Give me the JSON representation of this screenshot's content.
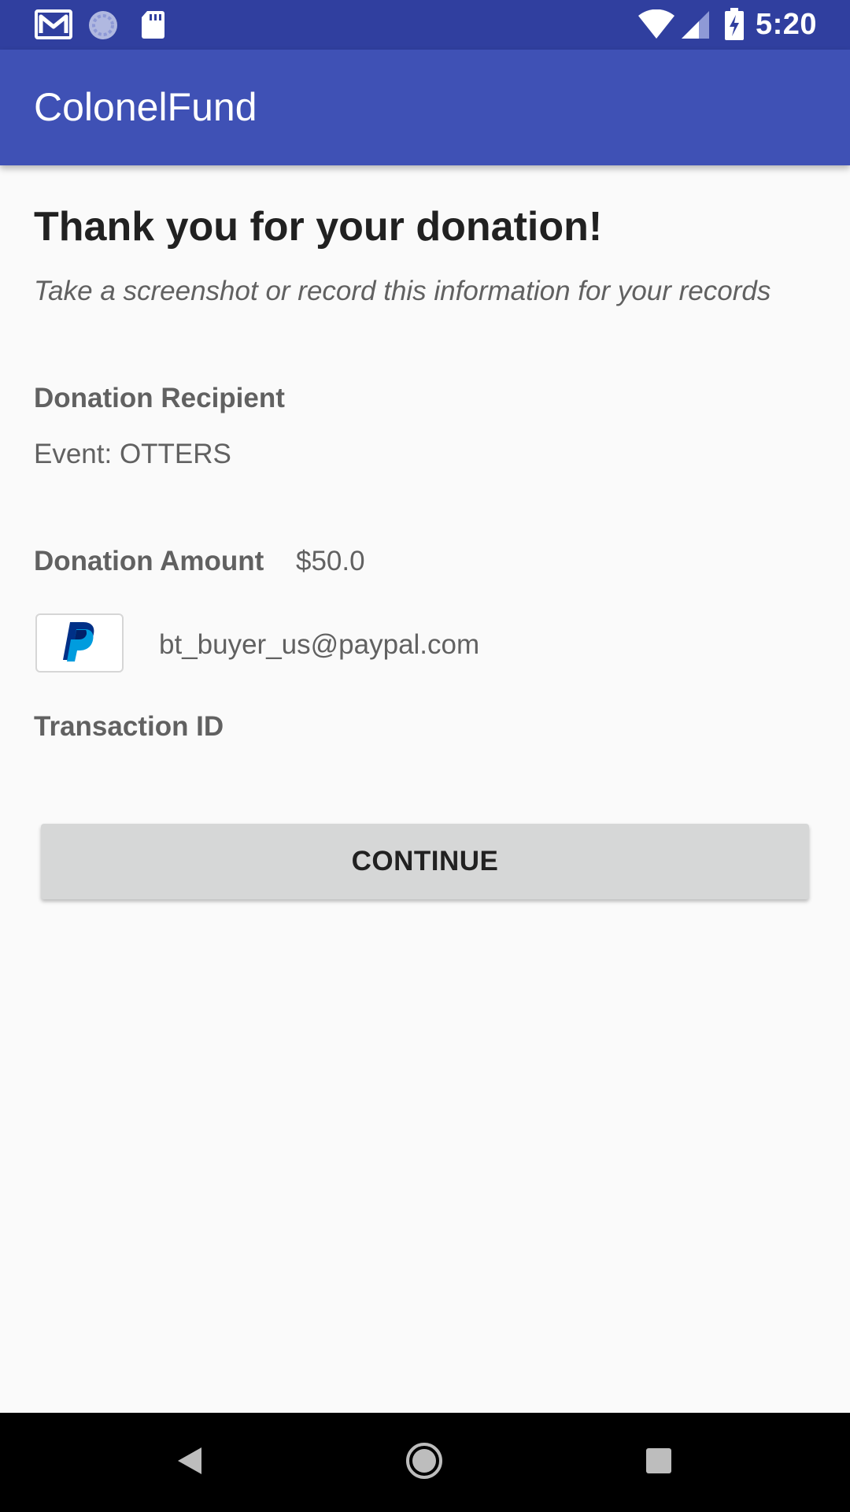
{
  "status_bar": {
    "time": "5:20",
    "icons": [
      "gmail-icon",
      "sync-icon",
      "sd-card-icon",
      "wifi-icon",
      "signal-icon",
      "battery-charging-icon"
    ]
  },
  "app_bar": {
    "title": "ColonelFund"
  },
  "confirmation": {
    "title": "Thank you for your donation!",
    "subtitle": "Take a screenshot or record this information for your records",
    "recipient_label": "Donation Recipient",
    "recipient_value": "Event: OTTERS",
    "amount_label": "Donation Amount",
    "amount_value": "$50.0",
    "payment_icon": "paypal-icon",
    "payment_email": "bt_buyer_us@paypal.com",
    "transaction_label": "Transaction ID",
    "continue_label": "CONTINUE"
  },
  "nav_bar": {
    "icons": [
      "back-icon",
      "home-icon",
      "recents-icon"
    ]
  },
  "colors": {
    "status_bar": "#303f9f",
    "app_bar": "#3f51b5",
    "background": "#fafafa",
    "button": "#d6d7d7",
    "paypal_dark": "#003087",
    "paypal_light": "#009cde"
  }
}
